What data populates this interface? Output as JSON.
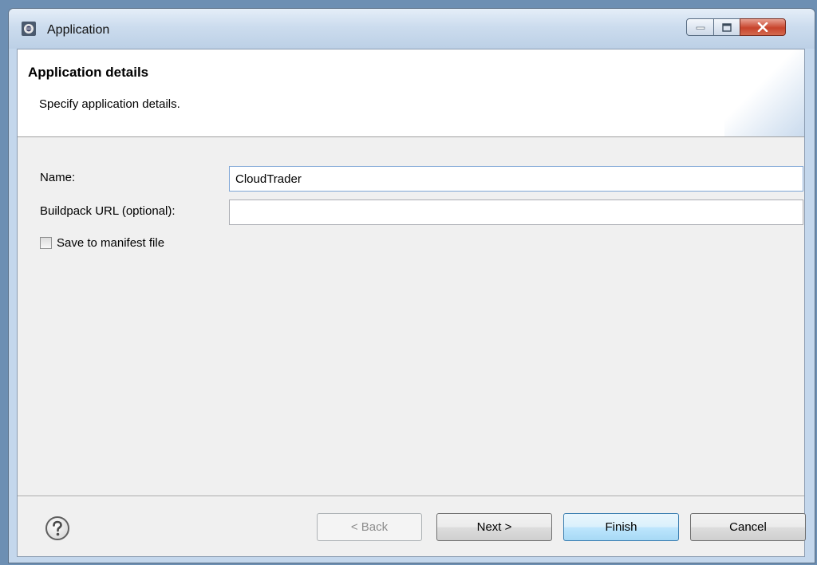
{
  "window": {
    "title": "Application",
    "controls": {
      "minimize_icon": "minimize-icon",
      "maximize_icon": "maximize-icon",
      "close_icon": "close-icon"
    }
  },
  "banner": {
    "title": "Application details",
    "description": "Specify application details."
  },
  "form": {
    "name_label": "Name:",
    "name_value": "CloudTrader",
    "buildpack_label": "Buildpack URL (optional):",
    "buildpack_value": "",
    "save_manifest_label": "Save to manifest file",
    "save_manifest_checked": false
  },
  "buttons": {
    "back": "< Back",
    "next": "Next >",
    "finish": "Finish",
    "cancel": "Cancel"
  },
  "colors": {
    "default_button_border": "#3c7fb1",
    "close_button": "#c7442c"
  }
}
